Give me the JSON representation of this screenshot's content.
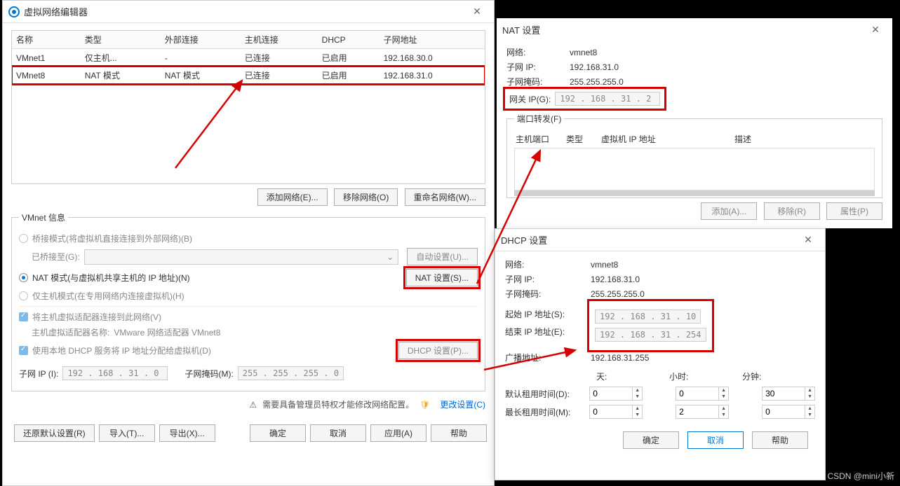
{
  "vne": {
    "title": "虚拟网络编辑器",
    "columns": {
      "name": "名称",
      "type": "类型",
      "external": "外部连接",
      "hostconn": "主机连接",
      "dhcp": "DHCP",
      "subnet": "子网地址"
    },
    "rows": [
      {
        "name": "VMnet1",
        "type": "仅主机...",
        "external": "-",
        "hostconn": "已连接",
        "dhcp": "已启用",
        "subnet": "192.168.30.0"
      },
      {
        "name": "VMnet8",
        "type": "NAT 模式",
        "external": "NAT 模式",
        "hostconn": "已连接",
        "dhcp": "已启用",
        "subnet": "192.168.31.0"
      }
    ],
    "add_btn": "添加网络(E)...",
    "remove_btn": "移除网络(O)",
    "rename_btn": "重命名网络(W)...",
    "info_legend": "VMnet 信息",
    "bridge_radio": "桥接模式(将虚拟机直接连接到外部网络)(B)",
    "bridged_to": "已桥接至(G):",
    "auto_set": "自动设置(U)...",
    "nat_radio": "NAT 模式(与虚拟机共享主机的 IP 地址)(N)",
    "nat_set": "NAT 设置(S)...",
    "hostonly_radio": "仅主机模式(在专用网络内连接虚拟机)(H)",
    "host_adapter_chk": "将主机虚拟适配器连接到此网络(V)",
    "host_adapter_name_lbl": "主机虚拟适配器名称:",
    "host_adapter_name": "VMware 网络适配器 VMnet8",
    "dhcp_chk": "使用本地 DHCP 服务将 IP 地址分配给虚拟机(D)",
    "dhcp_set": "DHCP 设置(P)...",
    "subnet_ip_lbl": "子网 IP (I):",
    "subnet_ip": "192 . 168 . 31 .  0",
    "subnet_mask_lbl": "子网掩码(M):",
    "subnet_mask": "255 . 255 . 255 .  0",
    "warn": "需要具备管理员特权才能修改网络配置。",
    "change_set": "更改设置(C)",
    "restore": "还原默认设置(R)",
    "import": "导入(T)...",
    "export": "导出(X)...",
    "ok": "确定",
    "cancel": "取消",
    "apply": "应用(A)",
    "help": "帮助"
  },
  "nat": {
    "title": "NAT 设置",
    "network_lbl": "网络:",
    "network": "vmnet8",
    "subnet_lbl": "子网 IP:",
    "subnet": "192.168.31.0",
    "mask_lbl": "子网掩码:",
    "mask": "255.255.255.0",
    "gateway_lbl": "网关 IP(G):",
    "gateway": "192 . 168 . 31 .  2",
    "pf_legend": "端口转发(F)",
    "pf_cols": {
      "c1": "主机端口",
      "c2": "类型",
      "c3": "虚拟机 IP 地址",
      "c4": "描述"
    },
    "add": "添加(A)...",
    "remove": "移除(R)",
    "props": "属性(P)"
  },
  "dhcp": {
    "title": "DHCP 设置",
    "network_lbl": "网络:",
    "network": "vmnet8",
    "subnet_lbl": "子网 IP:",
    "subnet": "192.168.31.0",
    "mask_lbl": "子网掩码:",
    "mask": "255.255.255.0",
    "start_lbl": "起始 IP 地址(S):",
    "start": "192 . 168 . 31 . 10",
    "end_lbl": "结束 IP 地址(E):",
    "end": "192 . 168 . 31 . 254",
    "broadcast_lbl": "广播地址:",
    "broadcast": "192.168.31.255",
    "days": "天:",
    "hours": "小时:",
    "minutes": "分钟:",
    "default_lease_lbl": "默认租用时间(D):",
    "max_lease_lbl": "最长租用时间(M):",
    "default_lease": {
      "d": "0",
      "h": "0",
      "m": "30"
    },
    "max_lease": {
      "d": "0",
      "h": "2",
      "m": "0"
    },
    "ok": "确定",
    "cancel": "取消",
    "help": "帮助"
  },
  "watermark": "CSDN @mini小新"
}
